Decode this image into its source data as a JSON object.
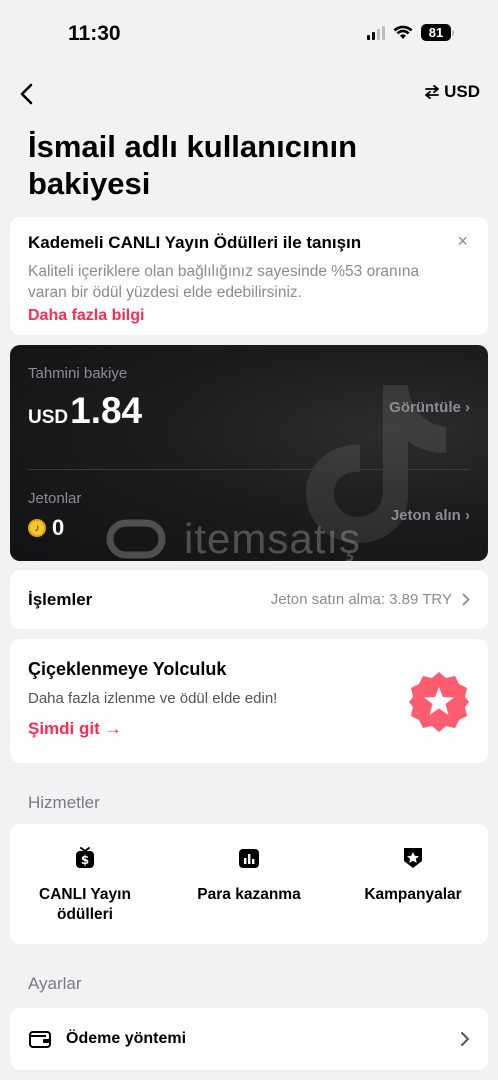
{
  "status_bar": {
    "time": "11:30",
    "battery": "81"
  },
  "nav": {
    "currency": "USD"
  },
  "page": {
    "title": "İsmail adlı kullanıcının bakiyesi"
  },
  "promo": {
    "title": "Kademeli CANLI Yayın Ödülleri ile tanışın",
    "text": "Kaliteli içeriklere olan bağlılığınız sayesinde %53 oranına varan bir ödül yüzdesi elde edebilirsiniz.",
    "link": "Daha fazla bilgi",
    "close": "×"
  },
  "balance": {
    "label": "Tahmini bakiye",
    "currency": "USD",
    "value": "1.84",
    "view": "Görüntüle ›",
    "coins_label": "Jetonlar",
    "coins_value": "0",
    "buy_coins": "Jeton alın ›",
    "watermark": "itemsatış"
  },
  "transactions": {
    "title": "İşlemler",
    "detail": "Jeton satın alma: 3.89 TRY"
  },
  "journey": {
    "title": "Çiçeklenmeye Yolculuk",
    "text": "Daha fazla izlenme ve ödül elde edin!",
    "link": "Şimdi git →"
  },
  "services": {
    "section_label": "Hizmetler",
    "items": [
      {
        "label": "CANLI Yayın ödülleri",
        "icon": "live-rewards-icon"
      },
      {
        "label": "Para kazanma",
        "icon": "monetization-icon"
      },
      {
        "label": "Kampanyalar",
        "icon": "campaigns-icon"
      }
    ]
  },
  "settings": {
    "section_label": "Ayarlar",
    "payment_method": "Ödeme yöntemi"
  },
  "colors": {
    "accent": "#fe2c55",
    "card_dark": "#1c1c1e",
    "background": "#f2f2f4"
  }
}
